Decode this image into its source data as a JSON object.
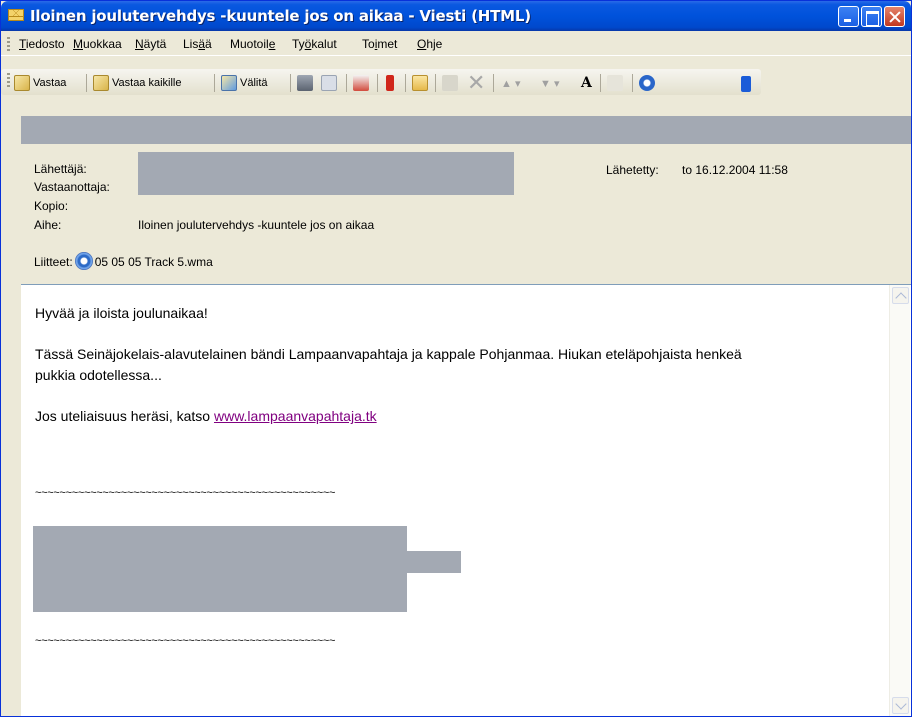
{
  "window": {
    "title": "Iloinen joulutervehdys -kuuntele jos on aikaa - Viesti (HTML)"
  },
  "menu": [
    {
      "pre": "",
      "u": "T",
      "post": "iedosto"
    },
    {
      "pre": "",
      "u": "M",
      "post": "uokkaa"
    },
    {
      "pre": "",
      "u": "N",
      "post": "äytä"
    },
    {
      "pre": "Lis",
      "u": "ä",
      "post": "ä"
    },
    {
      "pre": "Muotoil",
      "u": "e",
      "post": ""
    },
    {
      "pre": "Ty",
      "u": "ö",
      "post": "kalut"
    },
    {
      "pre": "To",
      "u": "i",
      "post": "met"
    },
    {
      "pre": "",
      "u": "O",
      "post": "hje"
    }
  ],
  "toolbar": {
    "reply": "Vastaa",
    "reply_all": "Vastaa kaikille",
    "forward": "Välitä",
    "icons": [
      "reply-icon",
      "reply-all-icon",
      "forward-icon",
      "print-icon",
      "copy-icon",
      "delete-flag-icon",
      "follow-up-flag-icon",
      "move-folder-icon",
      "paste-icon",
      "delete-icon",
      "previous-item-icon",
      "next-item-icon",
      "font-size-icon",
      "encoding-icon",
      "help-icon"
    ]
  },
  "header": {
    "from_label": "Lähettäjä:",
    "to_label": "Vastaanottaja:",
    "cc_label": "Kopio:",
    "subject_label": "Aihe:",
    "subject": "Iloinen joulutervehdys -kuuntele jos on aikaa",
    "sent_label": "Lähetetty:",
    "sent_value": "to 16.12.2004 11:58",
    "attachments_label": "Liitteet:",
    "attachment_name": "05 05 05 Track 5.wma"
  },
  "body": {
    "greeting": "Hyvää ja iloista  joulunaikaa!",
    "paragraph_line1": "Tässä Seinäjokelais-alavutelainen bändi Lampaanvapahtaja ja kappale Pohjanmaa. Hiukan eteläpohjaista henkeä",
    "paragraph_line2": "pukkia odotellessa...",
    "link_prefix": "Jos uteliaisuus heräsi, katso ",
    "link_text": "www.lampaanvapahtaja.tk",
    "separator": "~~~~~~~~~~~~~~~~~~~~~~~~~~~~~~~~~~~~~~~~~~~~~~~~~"
  }
}
